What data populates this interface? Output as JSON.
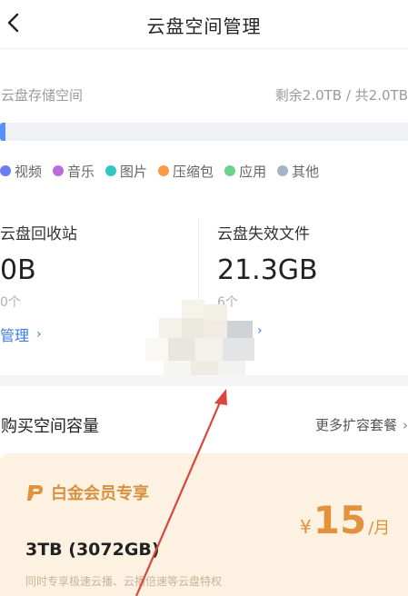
{
  "header": {
    "title": "云盘空间管理"
  },
  "storage": {
    "label": "云盘存储空间",
    "quota": "剩余2.0TB / 共2.0TB",
    "used_fraction": 0.01,
    "legend": [
      {
        "label": "视频",
        "color": "#6b7cf5"
      },
      {
        "label": "音乐",
        "color": "#c06ae0"
      },
      {
        "label": "图片",
        "color": "#31c7c2"
      },
      {
        "label": "压缩包",
        "color": "#fb9a45"
      },
      {
        "label": "应用",
        "color": "#6bd28a"
      },
      {
        "label": "其他",
        "color": "#a6b3c6"
      }
    ]
  },
  "recycle": {
    "title": "云盘回收站",
    "value": "0B",
    "count": "0个",
    "link": "管理"
  },
  "invalid": {
    "title": "云盘失效文件",
    "value": "21.3GB",
    "count": "6个"
  },
  "buy": {
    "title": "购买空间容量",
    "more": "更多扩容套餐"
  },
  "plan": {
    "badge": "白金会员专享",
    "size": "3TB (3072GB)",
    "desc": "同时专享极速云播、云播倍速等云盘特权",
    "price_symbol": "¥",
    "price": "15",
    "price_unit": "/月"
  },
  "colors": {
    "accent": "#3a7de0",
    "bar_fill": "#5b8ff9",
    "bar_track": "#eff1f4",
    "plan_bg": "#fdf1e2",
    "plan_gold": "#e3913a",
    "annotation_arrow": "#d9463d"
  }
}
